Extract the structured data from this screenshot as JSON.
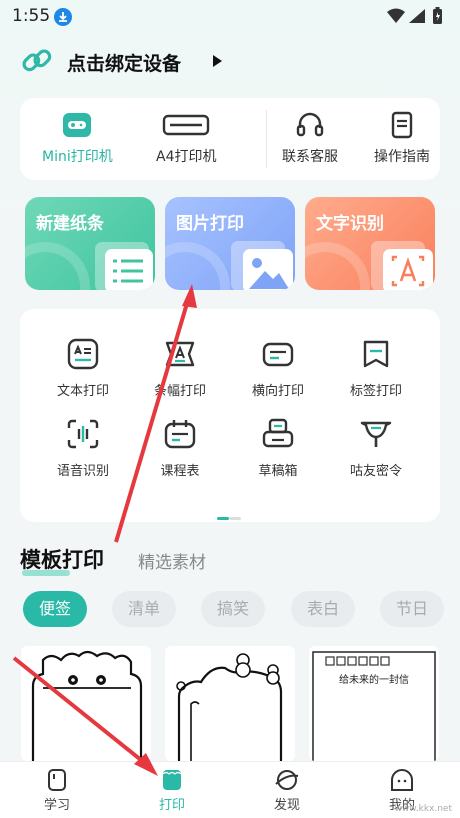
{
  "status": {
    "time": "1:55"
  },
  "header": {
    "title": "点击绑定设备"
  },
  "devices": [
    {
      "label": "Mini打印机",
      "active": true
    },
    {
      "label": "A4打印机",
      "active": false
    },
    {
      "label": "联系客服",
      "active": false
    },
    {
      "label": "操作指南",
      "active": false
    }
  ],
  "features": [
    {
      "label": "新建纸条"
    },
    {
      "label": "图片打印"
    },
    {
      "label": "文字识别"
    }
  ],
  "tools": [
    {
      "label": "文本打印"
    },
    {
      "label": "条幅打印"
    },
    {
      "label": "横向打印"
    },
    {
      "label": "标签打印"
    },
    {
      "label": "语音识别"
    },
    {
      "label": "课程表"
    },
    {
      "label": "草稿箱"
    },
    {
      "label": "咕友密令"
    }
  ],
  "section_tabs": {
    "active": "模板打印",
    "other": "精选素材"
  },
  "chips": [
    "便签",
    "清单",
    "搞笑",
    "表白",
    "节日"
  ],
  "templates": {
    "third_title": "给未来的一封信"
  },
  "nav": [
    {
      "label": "学习"
    },
    {
      "label": "打印"
    },
    {
      "label": "发现"
    },
    {
      "label": "我的"
    }
  ],
  "watermark": "www.kkx.net",
  "colors": {
    "accent": "#29b9a6",
    "annotation_arrow": "#e5393f"
  }
}
